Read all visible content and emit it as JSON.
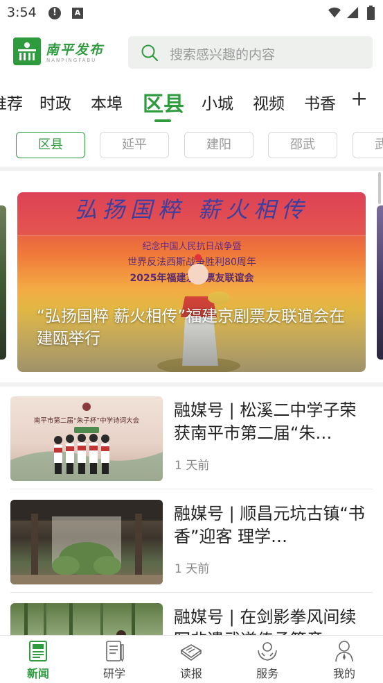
{
  "status_bar": {
    "time": "3:54"
  },
  "header": {
    "logo_text": "南平发布",
    "logo_subtext": "NANPINGFABU",
    "search_placeholder": "搜索感兴趣的内容"
  },
  "nav_tabs": [
    {
      "label": "推荐",
      "active": false
    },
    {
      "label": "时政",
      "active": false
    },
    {
      "label": "本埠",
      "active": false
    },
    {
      "label": "区县",
      "active": true
    },
    {
      "label": "小城",
      "active": false
    },
    {
      "label": "视频",
      "active": false
    },
    {
      "label": "书香",
      "active": false
    }
  ],
  "nav_plus": "+",
  "sub_tabs": [
    {
      "label": "区县",
      "active": true
    },
    {
      "label": "延平",
      "active": false
    },
    {
      "label": "建阳",
      "active": false
    },
    {
      "label": "邵武",
      "active": false
    },
    {
      "label": "武夷",
      "active": false
    }
  ],
  "banner": {
    "caption": "“弘扬国粹 薪火相传”福建京剧票友联谊会在建瓯举行",
    "art_text": "弘扬国粹 薪火相传",
    "art_subtitle_1": "纪念中国人民抗日战争暨",
    "art_subtitle_2": "世界反法西斯战争胜利80周年",
    "art_subtitle_3": "2025年福建京剧票友联谊会"
  },
  "news": [
    {
      "title": "融媒号 | 松溪二中学子荣获南平市第二届“朱…",
      "time": "1 天前",
      "thumb_text": "南平市第二届“朱子杯”中学诗词大会"
    },
    {
      "title": "融媒号 | 顺昌元坑古镇“书香”迎客 理学…",
      "time": "1 天前"
    },
    {
      "title": "融媒号 | 在剑影拳风间续写非遗武道传承篇章",
      "time": ""
    }
  ],
  "bottom_nav": [
    {
      "label": "新闻",
      "icon": "newspaper-icon",
      "active": true
    },
    {
      "label": "研学",
      "icon": "notebook-icon",
      "active": false
    },
    {
      "label": "读报",
      "icon": "paper-icon",
      "active": false
    },
    {
      "label": "服务",
      "icon": "service-hands-icon",
      "active": false
    },
    {
      "label": "我的",
      "icon": "person-icon",
      "active": false
    }
  ],
  "colors": {
    "brand": "#2e9b3f",
    "text": "#222222",
    "muted": "#888888"
  }
}
